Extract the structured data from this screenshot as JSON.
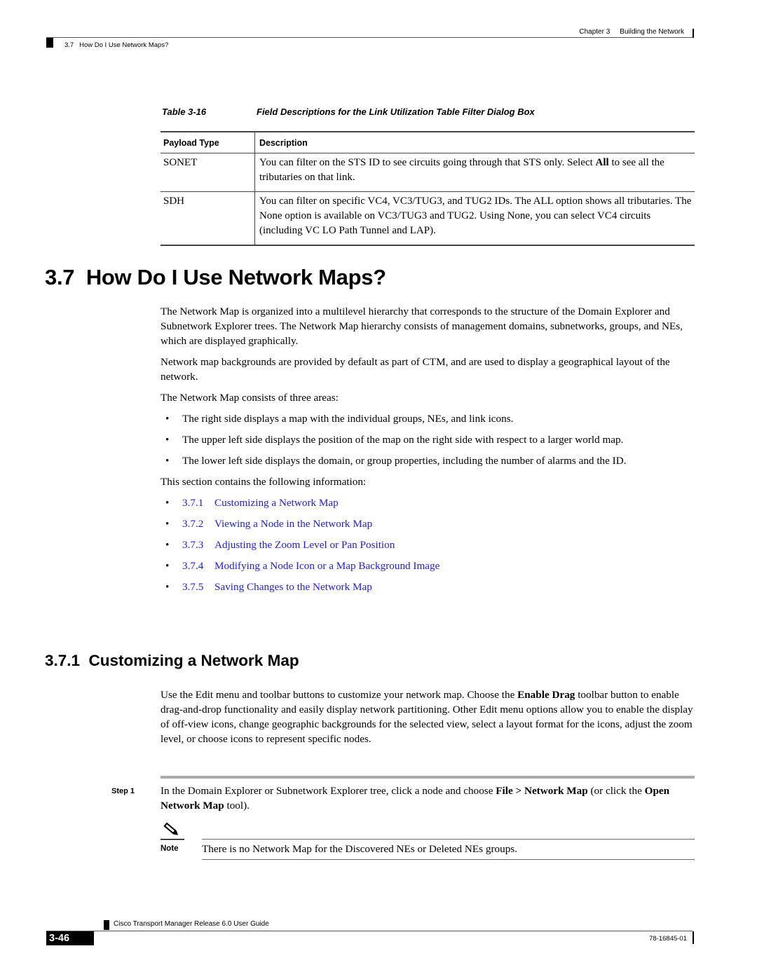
{
  "header": {
    "chapter_label": "Chapter 3",
    "chapter_title": "Building the Network",
    "section": "3.7   How Do I Use Network Maps?"
  },
  "table": {
    "caption_number": "Table 3-16",
    "caption_title": "Field Descriptions for the Link Utilization Table Filter Dialog Box",
    "columns": [
      "Payload Type",
      "Description"
    ],
    "rows": [
      {
        "type": "SONET",
        "desc_before": "You can filter on the STS ID to see circuits going through that STS only. Select ",
        "desc_bold": "All",
        "desc_after": " to see all the tributaries on that link."
      },
      {
        "type": "SDH",
        "desc_before": "You can filter on specific VC4, VC3/TUG3, and TUG2 IDs. The ALL option shows all tributaries. The None option is available on VC3/TUG3 and TUG2. Using None, you can select VC4 circuits (including VC LO Path Tunnel and LAP).",
        "desc_bold": "",
        "desc_after": ""
      }
    ]
  },
  "section": {
    "heading": "3.7  How Do I Use Network Maps?",
    "paragraphs": [
      "The Network Map is organized into a multilevel hierarchy that corresponds to the structure of the Domain Explorer and Subnetwork Explorer trees. The Network Map hierarchy consists of management domains, subnetworks, groups, and NEs, which are displayed graphically.",
      "Network map backgrounds are provided by default as part of CTM, and are used to display a geographical layout of the network.",
      "The Network Map consists of three areas:"
    ],
    "bullets": [
      "The right side displays a map with the individual groups, NEs, and link icons.",
      "The upper left side displays the position of the map on the right side with respect to a larger world map.",
      "The lower left side displays the domain, or group properties, including the number of alarms and the ID."
    ],
    "contents_intro": "This section contains the following information:",
    "links": [
      {
        "num": "3.7.1",
        "title": "Customizing a Network Map"
      },
      {
        "num": "3.7.2",
        "title": "Viewing a Node in the Network Map"
      },
      {
        "num": "3.7.3",
        "title": "Adjusting the Zoom Level or Pan Position"
      },
      {
        "num": "3.7.4",
        "title": "Modifying a Node Icon or a Map Background Image"
      },
      {
        "num": "3.7.5",
        "title": "Saving Changes to the Network Map"
      }
    ],
    "link_color": "#1a1aff"
  },
  "subsection": {
    "heading": "3.7.1  Customizing a Network Map",
    "para_before": "Use the Edit menu and toolbar buttons to customize your network map. Choose the ",
    "para_bold": "Enable Drag",
    "para_after": " toolbar button to enable drag-and-drop functionality and easily display network partitioning. Other Edit menu options allow you to enable the display of off-view icons, change geographic backgrounds for the selected view, select a layout format for the icons, adjust the zoom level, or choose icons to represent specific nodes."
  },
  "step": {
    "label": "Step 1",
    "text_1": "In the Domain Explorer or Subnetwork Explorer tree, click a node and choose ",
    "bold_1": "File > Network Map",
    "text_2": " (or click the ",
    "bold_2": "Open Network Map",
    "text_3": " tool)."
  },
  "note": {
    "icon": "pencil-icon",
    "label": "Note",
    "text": "There is no Network Map for the Discovered NEs or Deleted NEs groups."
  },
  "footer": {
    "guide_title": "Cisco Transport Manager Release 6.0 User Guide",
    "page_number": "3-46",
    "doc_number": "78-16845-01"
  }
}
